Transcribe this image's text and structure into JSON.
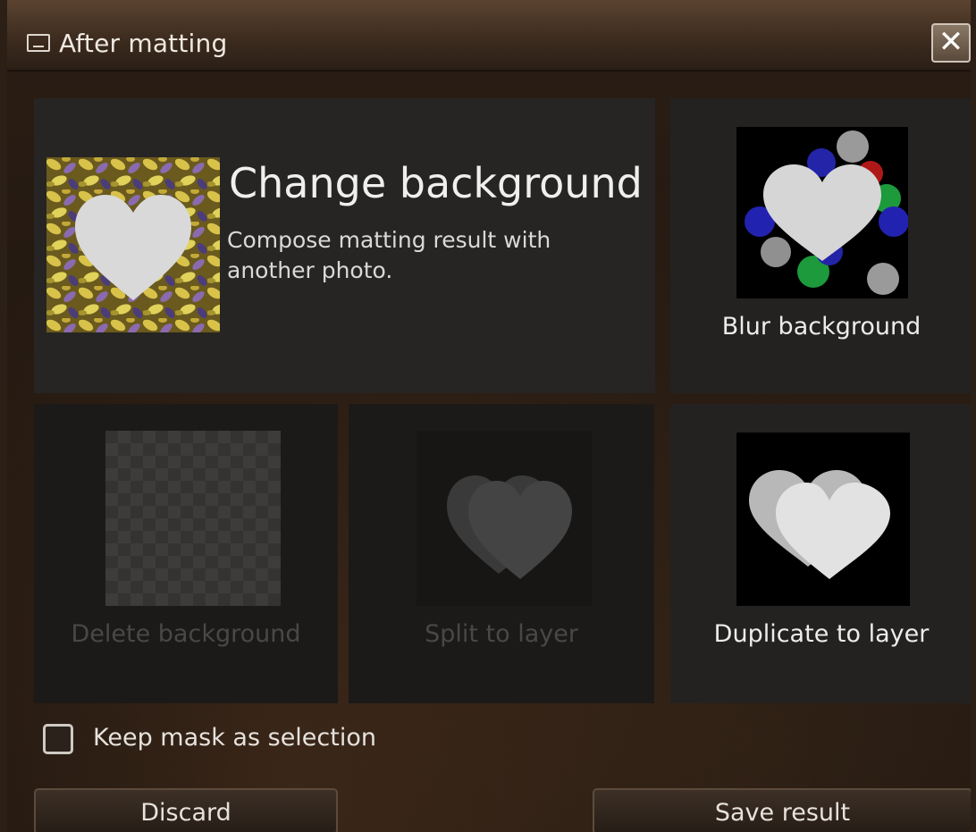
{
  "window": {
    "title": "After matting",
    "close_label": "✕"
  },
  "options": {
    "change_background": {
      "title": "Change background",
      "description": "Compose matting result with another photo."
    },
    "blur_background": {
      "label": "Blur background",
      "enabled": true
    },
    "delete_background": {
      "label": "Delete background",
      "enabled": false
    },
    "split_to_layer": {
      "label": "Split to layer",
      "enabled": false
    },
    "duplicate_to_layer": {
      "label": "Duplicate to layer",
      "enabled": true
    }
  },
  "keep_mask": {
    "label": "Keep mask as selection",
    "checked": false
  },
  "buttons": {
    "discard": "Discard",
    "save": "Save result"
  },
  "icons": {
    "window": "window-icon",
    "close": "close-icon"
  },
  "colors": {
    "titlebar": "#4a3526",
    "tile_active": "#262523",
    "tile_disabled": "#1c1a18",
    "text_enabled": "#ececec",
    "text_disabled": "#4a4846"
  }
}
